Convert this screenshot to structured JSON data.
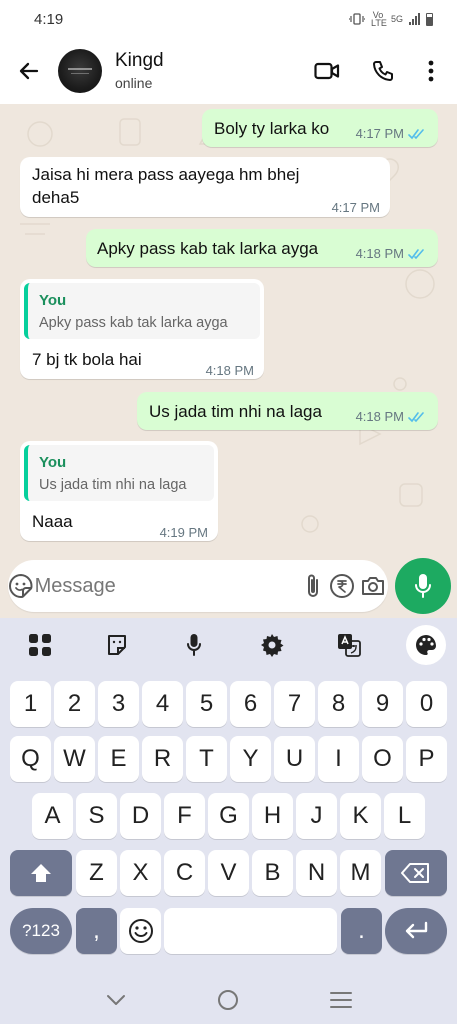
{
  "status_bar": {
    "time": "4:19",
    "network": "5G",
    "volte": "Vo LTE"
  },
  "header": {
    "contact_name": "Kingd",
    "contact_status": "online"
  },
  "messages": [
    {
      "direction": "out",
      "text": "Boly ty larka ko",
      "time": "4:17 PM",
      "read": true
    },
    {
      "direction": "in",
      "text_line1": "Jaisa hi mera pass aayega hm bhej",
      "text_line2": "deha5",
      "time": "4:17 PM"
    },
    {
      "direction": "out",
      "text": "Apky pass kab tak larka ayga",
      "time": "4:18 PM",
      "read": true
    },
    {
      "direction": "in",
      "quote_author": "You",
      "quote_text": "Apky pass kab tak larka ayga",
      "text": "7 bj tk bola hai",
      "time": "4:18 PM"
    },
    {
      "direction": "out",
      "text": "Us jada tim nhi na laga",
      "time": "4:18 PM",
      "read": true
    },
    {
      "direction": "in",
      "quote_author": "You",
      "quote_text": "Us jada tim nhi na laga",
      "text": "Naaa",
      "time": "4:19 PM"
    }
  ],
  "composer": {
    "placeholder": "Message"
  },
  "keyboard": {
    "number_row": [
      "1",
      "2",
      "3",
      "4",
      "5",
      "6",
      "7",
      "8",
      "9",
      "0"
    ],
    "row1": [
      "Q",
      "W",
      "E",
      "R",
      "T",
      "Y",
      "U",
      "I",
      "O",
      "P"
    ],
    "row2": [
      "A",
      "S",
      "D",
      "F",
      "G",
      "H",
      "J",
      "K",
      "L"
    ],
    "row3": [
      "Z",
      "X",
      "C",
      "V",
      "B",
      "N",
      "M"
    ],
    "symbols_key": "?123",
    "comma_key": ",",
    "period_key": "."
  },
  "colors": {
    "accent": "#1daa61",
    "outgoing_bubble": "#d9fdd3",
    "read_ticks": "#53bdeb",
    "chat_bg": "#efe7de",
    "keyboard_bg": "#e2e4f0"
  }
}
